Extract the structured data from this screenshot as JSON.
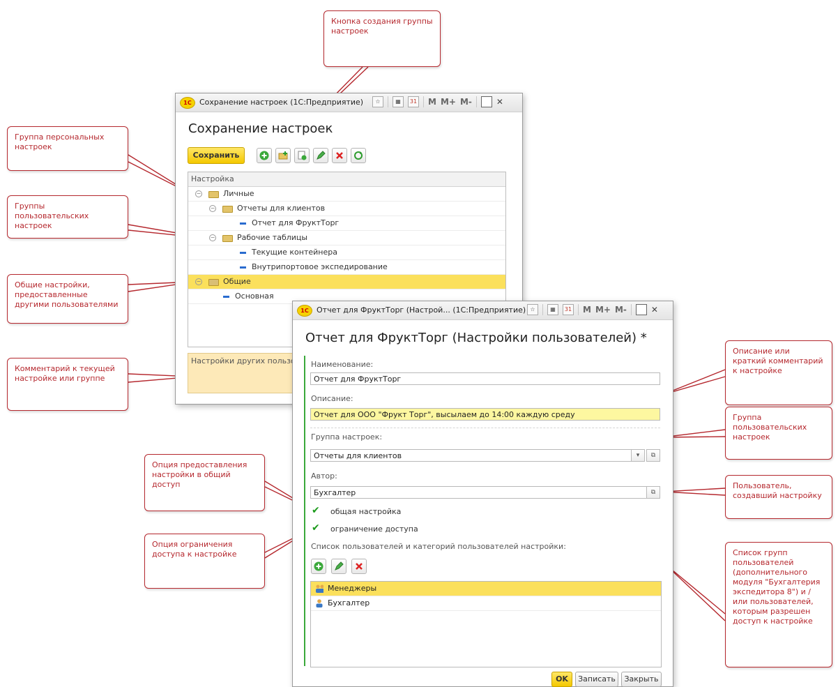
{
  "callouts": {
    "create_group": "Кнопка создания группы настроек",
    "personal_group": "Группа персональных настроек",
    "user_groups": "Группы пользовательских настроек",
    "shared_settings": "Общие настройки, предоставленные другими пользователями",
    "comment": "Комментарий к текущей настройке или группе",
    "description": "Описание или краткий комментарий к настройке",
    "group_right": "Группа пользовательских настроек",
    "author": "Пользователь, создавший настройку",
    "share_option": "Опция предоставления настройки в общий доступ",
    "restrict_option": "Опция ограничения доступа к настройке",
    "users_list": "Список групп пользователей (дополнительного модуля \"Бухгалтерия экспедитора 8\") и / или пользователей, которым разрешен доступ к настройке"
  },
  "window1": {
    "title": "Сохранение настроек  (1С:Предприятие)",
    "heading": "Сохранение настроек",
    "save_label": "Сохранить",
    "tree_header": "Настройка",
    "tree": [
      {
        "label": "Личные"
      },
      {
        "label": "Отчеты для клиентов"
      },
      {
        "label": "Отчет для ФруктТорг"
      },
      {
        "label": "Рабочие таблицы"
      },
      {
        "label": "Текущие контейнера"
      },
      {
        "label": "Внутрипортовое экспедирование"
      },
      {
        "label": "Общие"
      },
      {
        "label": "Основная"
      }
    ],
    "comment_text": "Настройки других пользо"
  },
  "titlebar": {
    "m": "M",
    "mplus": "M+",
    "mminus": "M-",
    "logo": "1С"
  },
  "window2": {
    "title": "Отчет для ФруктТорг (Настрой...  (1С:Предприятие)",
    "heading": "Отчет для ФруктТорг (Настройки пользователей) *",
    "name_label": "Наименование:",
    "name_value": "Отчет для ФруктТорг",
    "desc_label": "Описание:",
    "desc_value": "Отчет для ООО \"Фрукт Торг\", высылаем до 14:00 каждую среду",
    "group_label": "Группа настроек:",
    "group_value": "Отчеты для клиентов",
    "author_label": "Автор:",
    "author_value": "Бухгалтер",
    "shared_label": "общая настройка",
    "restrict_label": "ограничение доступа",
    "users_list_label": "Список пользователей и категорий пользователей настройки:",
    "users": [
      {
        "label": "Менеджеры"
      },
      {
        "label": "Бухгалтер"
      }
    ],
    "ok_label": "OK",
    "write_label": "Записать",
    "close_label": "Закрыть"
  }
}
